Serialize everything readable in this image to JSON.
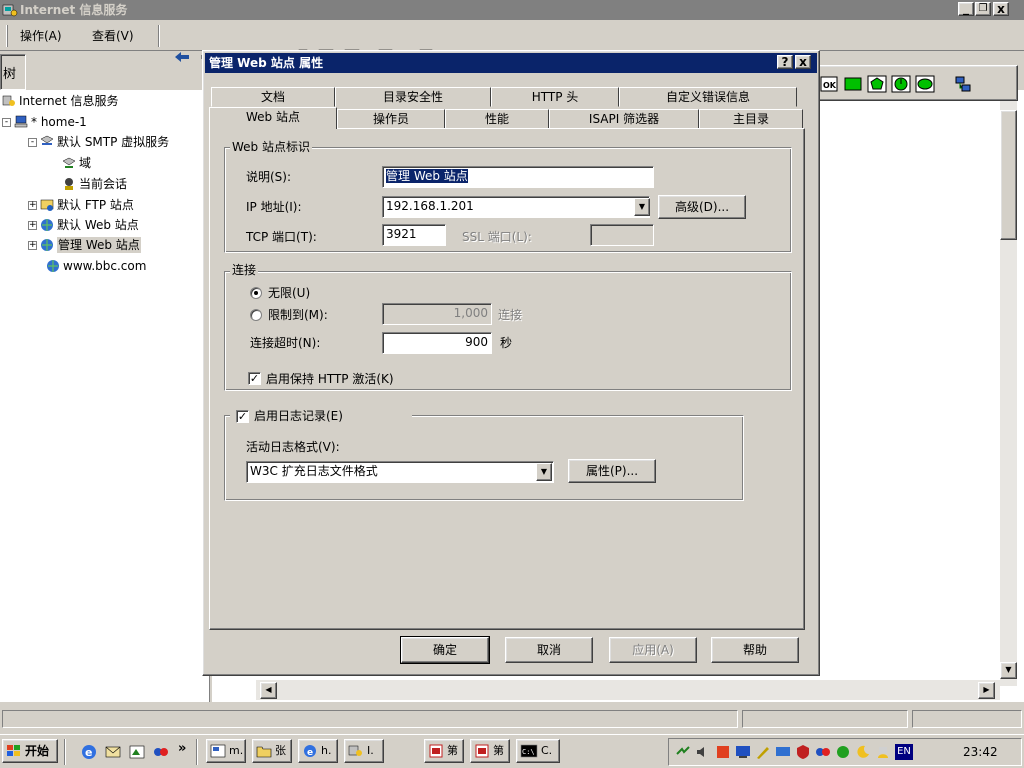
{
  "app": {
    "title": "Internet 信息服务",
    "window_buttons": [
      "_",
      "🗗",
      "x"
    ]
  },
  "menubar": {
    "action": "操作(A)",
    "view": "查看(V)"
  },
  "tree": {
    "header": "树",
    "items": [
      {
        "label": "Internet 信息服务",
        "icon": "iis-icon"
      },
      {
        "label": "* home-1",
        "icon": "computer-icon",
        "expander": "-"
      },
      {
        "label": "默认 SMTP 虚拟服务",
        "icon": "smtp-icon",
        "expander": "-"
      },
      {
        "label": "域",
        "icon": "domain-icon"
      },
      {
        "label": "当前会话",
        "icon": "session-icon"
      },
      {
        "label": "默认 FTP 站点",
        "icon": "ftp-icon",
        "expander": "+"
      },
      {
        "label": "默认 Web 站点",
        "icon": "web-site-icon",
        "expander": "+"
      },
      {
        "label": "管理 Web 站点",
        "icon": "web-site-icon",
        "expander": "+"
      },
      {
        "label": "www.bbc.com",
        "icon": "web-site-icon"
      }
    ]
  },
  "dialog": {
    "title": "管理 Web 站点 属性",
    "help_btn": "?",
    "close_btn": "x",
    "tabs_row1": [
      "文档",
      "目录安全性",
      "HTTP 头",
      "自定义错误信息"
    ],
    "tabs_row2": [
      "Web 站点",
      "操作员",
      "性能",
      "ISAPI 筛选器",
      "主目录"
    ],
    "identity_group": "Web 站点标识",
    "description_label": "说明(S):",
    "description_value": "管理 Web 站点",
    "ip_label": "IP 地址(I):",
    "ip_value": "192.168.1.201",
    "advanced_btn": "高级(D)...",
    "tcp_label": "TCP 端口(T):",
    "tcp_value": "3921",
    "ssl_label": "SSL 端口(L):",
    "ssl_value": "",
    "connection_group": "连接",
    "unlimited_label": "无限(U)",
    "limited_label": "限制到(M):",
    "limited_value": "1,000",
    "connections_unit": "连接",
    "timeout_label": "连接超时(N):",
    "timeout_value": "900",
    "seconds_unit": "秒",
    "keepalive_label": "启用保持 HTTP 激活(K)",
    "keepalive_checked": true,
    "logging_label": "启用日志记录(E)",
    "logging_checked": true,
    "log_format_label": "活动日志格式(V):",
    "log_format_value": "W3C 扩充日志文件格式",
    "properties_btn": "属性(P)...",
    "ok_btn": "确定",
    "cancel_btn": "取消",
    "apply_btn": "应用(A)",
    "help_button": "帮助"
  },
  "taskbar": {
    "start": "开始",
    "clock": "23:42",
    "lang": "EN",
    "chevron": "»",
    "tasks": [
      {
        "label": "m.",
        "icon": "console-icon"
      },
      {
        "label": "张",
        "icon": "folder-icon"
      },
      {
        "label": "h.",
        "icon": "ie-icon"
      },
      {
        "label": "I.",
        "icon": "iis-icon"
      },
      {
        "label": "第",
        "icon": "doc-icon"
      },
      {
        "label": "第",
        "icon": "doc-icon"
      },
      {
        "label": "C.",
        "icon": "cmd-icon"
      }
    ]
  },
  "colors": {
    "face": "#d4d0c8",
    "titlebar_inactive": "#808080",
    "titlebar_active": "#0a246a",
    "selection": "#0a246a"
  }
}
